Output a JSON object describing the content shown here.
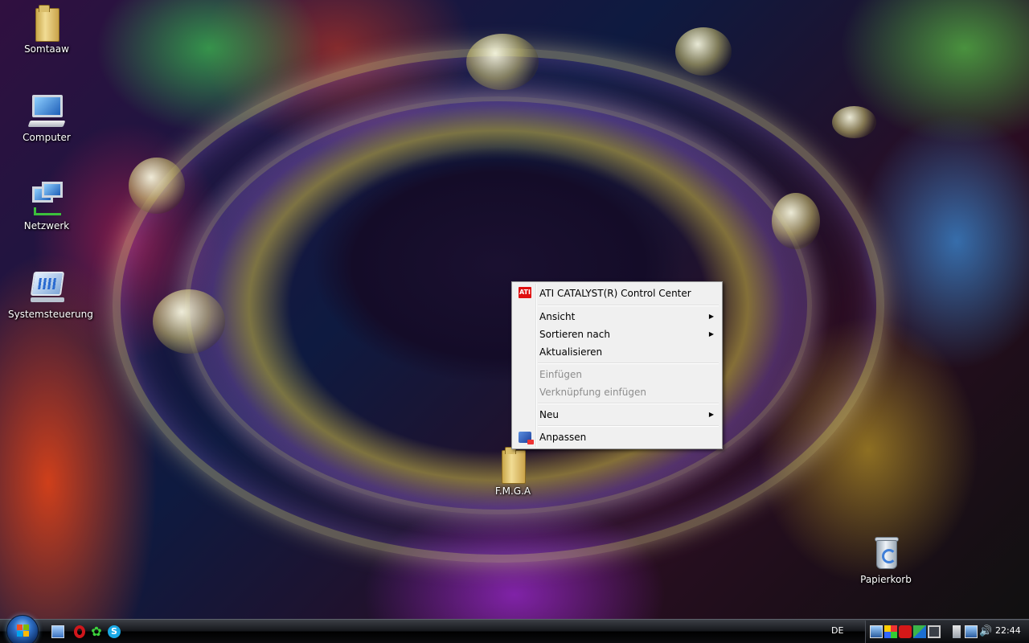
{
  "desktop": {
    "icons": [
      {
        "label": "Somtaaw",
        "icon": "folder-icon"
      },
      {
        "label": "Computer",
        "icon": "computer-icon"
      },
      {
        "label": "Netzwerk",
        "icon": "network-icon"
      },
      {
        "label": "Systemsteuerung",
        "icon": "control-panel-icon"
      },
      {
        "label": "F.M.G.A",
        "icon": "folder-icon"
      },
      {
        "label": "Papierkorb",
        "icon": "recycle-bin-icon"
      }
    ]
  },
  "context_menu": {
    "items": [
      {
        "label": "ATI CATALYST(R) Control Center",
        "icon": "ati-icon",
        "logo_text": "ATI"
      },
      {
        "label": "Ansicht",
        "submenu": true
      },
      {
        "label": "Sortieren nach",
        "submenu": true
      },
      {
        "label": "Aktualisieren"
      },
      {
        "label": "Einfügen",
        "disabled": true
      },
      {
        "label": "Verknüpfung einfügen",
        "disabled": true
      },
      {
        "label": "Neu",
        "submenu": true
      },
      {
        "label": "Anpassen",
        "icon": "personalize-icon"
      }
    ],
    "arrow_glyph": "▶"
  },
  "taskbar": {
    "quick_launch": [
      "show-desktop-icon",
      "opera-icon",
      "icq-icon",
      "skype-icon"
    ],
    "skype_glyph": "S",
    "icq_glyph": "✿",
    "language": "DE",
    "tray_icons": [
      "display-icon",
      "color-icon",
      "acrobat-icon",
      "app-icon",
      "monitor-icon",
      "battery-icon",
      "network-icon",
      "volume-icon"
    ],
    "volume_glyph": "🔊",
    "clock": "22:44"
  },
  "colors": {
    "menu_bg": "#f0f0f0",
    "taskbar_bg": "#0b0c0e",
    "disabled_text": "#8d8d8d"
  }
}
